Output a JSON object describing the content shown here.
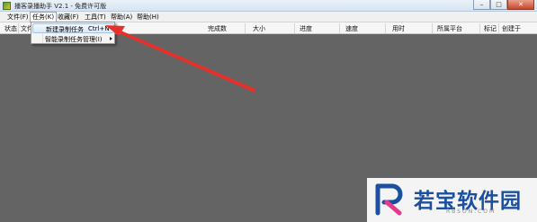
{
  "window": {
    "title": "播客录播助手 V2.1 - 免费许可版",
    "controls": {
      "minimize": "–",
      "maximize": "□",
      "close": "✕"
    }
  },
  "menubar": {
    "items": [
      {
        "label": "文件(F)"
      },
      {
        "label": "任务(K)"
      },
      {
        "label": "收藏(F)"
      },
      {
        "label": "工具(T)"
      },
      {
        "label": "帮助(A)"
      },
      {
        "label": "帮助(H)"
      }
    ]
  },
  "columns": {
    "status": "状态",
    "file": "文件",
    "completed": "完成数",
    "size": "大小",
    "progress": "进度",
    "speed": "速度",
    "time": "用时",
    "platform": "所属平台",
    "tag": "标记",
    "creator": "创建于"
  },
  "task_menu": {
    "items": [
      {
        "label": "新建录制任务",
        "shortcut": "Ctrl+N"
      },
      {
        "label": "智能录制任务管理(I)",
        "shortcut": ""
      }
    ]
  },
  "annotation": {
    "color": "#e8302a"
  },
  "watermark": {
    "text": "若宝软件园",
    "domain": "RBSON.COM",
    "colors": {
      "primary": "#1b4fa0",
      "accent": "#e83a8c"
    }
  }
}
